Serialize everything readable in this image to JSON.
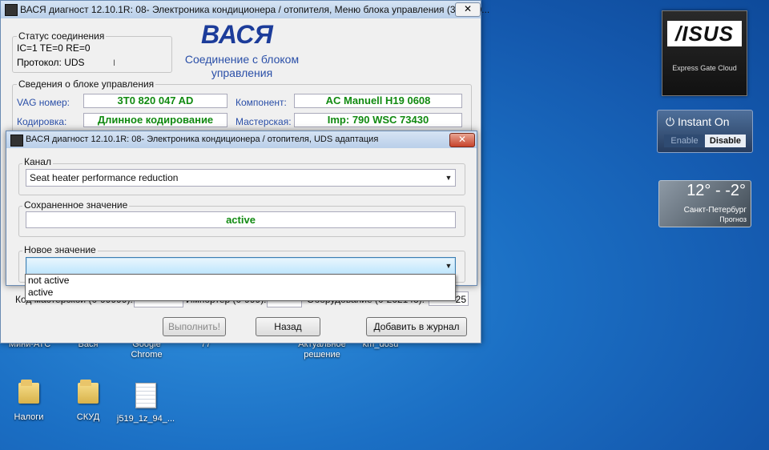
{
  "desktop": {
    "row1_labels": [
      "Мини-АТС",
      "Вася",
      "Google\nChrome",
      "77",
      "Актуальное\nрешение",
      "km_dosu"
    ],
    "icons": [
      {
        "name": "Налоги",
        "type": "folder"
      },
      {
        "name": "СКУД",
        "type": "folder"
      },
      {
        "name": "j519_1z_94_...",
        "type": "document"
      }
    ]
  },
  "gadgets": {
    "asus": {
      "logo": "/ISUS",
      "subtitle": "Express Gate Cloud"
    },
    "instant_on": {
      "title": "Instant On",
      "enable": "Enable",
      "disable": "Disable",
      "icon": "power-icon"
    },
    "weather": {
      "temp": "12° - -2°",
      "city": "Санкт-Петербург",
      "forecast": "Прогноз"
    }
  },
  "main_window": {
    "title": "ВАСЯ диагност 12.10.1R: 08- Электроника кондиционера / отопителя,  Меню блока управления (3С8-90...",
    "close": "✕",
    "connection": {
      "label": "Статус соединения",
      "line1": "IC=1  TE=0  RE=0",
      "protocol": "Протокол: UDS",
      "cursor": "I"
    },
    "app_name": "ВАСЯ",
    "app_subtitle": "Соединение с блоком управления",
    "info": {
      "label": "Сведения о блоке управления",
      "vag_label": "VAG номер:",
      "vag_value": "3T0 820 047 AD",
      "component_label": "Компонент:",
      "component_value": "AC Manuell    H19 0608",
      "coding_label": "Кодировка:",
      "coding_value": "Длинное кодирование",
      "shop_label": "Мастерская:",
      "shop_value": "Imp: 790    WSC 73430"
    },
    "bottom_row": {
      "shop_code_label": "Код мастерской (0-99999):",
      "importer_label": "Импортер (0-999):",
      "equipment_label": "Оборудование (0-262143):",
      "equipment_value_tail": "25"
    }
  },
  "dialog": {
    "title": "ВАСЯ диагност 12.10.1R: 08- Электроника кондиционера / отопителя,  UDS адаптация",
    "close": "✕",
    "channel_label": "Канал",
    "channel_value": "Seat heater performance reduction",
    "saved_label": "Сохраненное значение",
    "saved_value": "active",
    "new_label": "Новое значение",
    "new_value": "",
    "dropdown_options": [
      "not active",
      "active"
    ],
    "buttons": {
      "execute": "Выполнить!",
      "back": "Назад",
      "add_log": "Добавить в журнал"
    }
  }
}
